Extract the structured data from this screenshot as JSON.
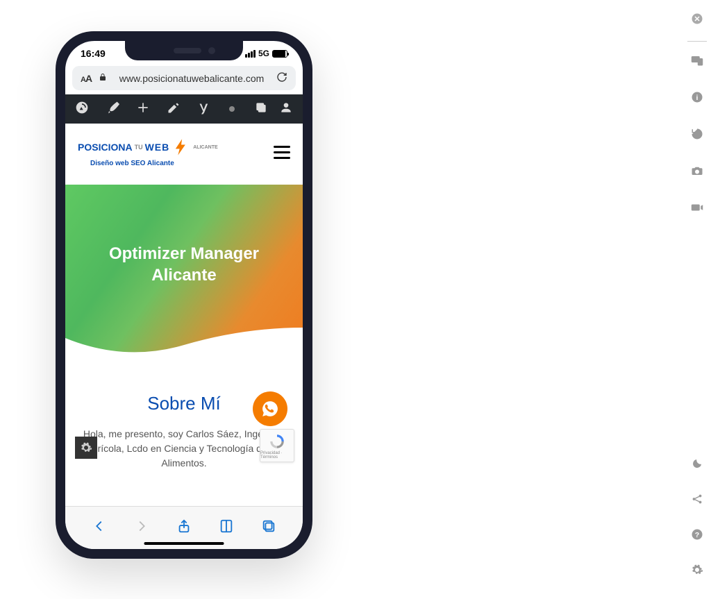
{
  "status": {
    "time": "16:49",
    "network": "5G"
  },
  "browser": {
    "url": "www.posicionatuwebalicante.com"
  },
  "logo": {
    "posiciona": "POSICIONA",
    "tu": "TU",
    "web": "WEB",
    "alicante": "ALICANTE",
    "tagline": "Diseño web SEO Alicante"
  },
  "hero": {
    "title_line1": "Optimizer Manager",
    "title_line2": "Alicante"
  },
  "about": {
    "title": "Sobre Mí",
    "text": "Hola,  me presento, soy Carlos Sáez, Ingeniero Agrícola, Lcdo en Ciencia y Tecnología de los Alimentos."
  },
  "recaptcha": {
    "label": "Privacidad · Términos"
  }
}
